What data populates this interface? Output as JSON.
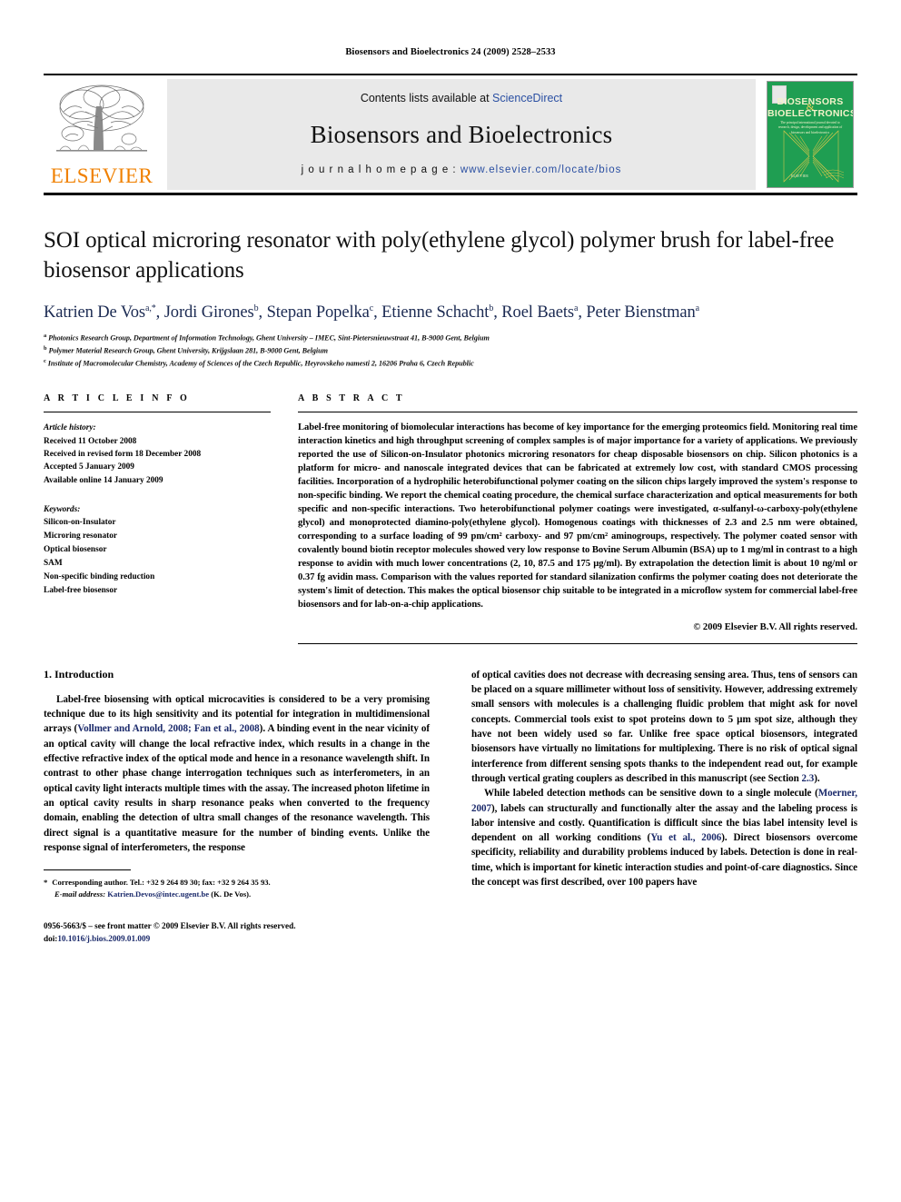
{
  "running_head": "Biosensors and Bioelectronics 24 (2009) 2528–2533",
  "masthead": {
    "publisher_name": "ELSEVIER",
    "contents_line": "Contents lists available at ",
    "sciencedirect": "ScienceDirect",
    "journal_title": "Biosensors and Bioelectronics",
    "homepage_label": "j o u r n a l   h o m e p a g e :  ",
    "homepage_url": "www.elsevier.com/locate/bios",
    "cover": {
      "title_line1": "BIOSENSORS",
      "amp": "&",
      "title_line2": "BIOELECTRONICS",
      "subtitle": "The principal international journal devoted to research, design, development and application of biosensors and bioelectronics",
      "publisher": "ELSEVIER",
      "background_color": "#1f9e52"
    }
  },
  "article": {
    "title": "SOI optical microring resonator with poly(ethylene glycol) polymer brush for label-free biosensor applications",
    "authors_html": "Katrien De Vos<sup>a,</sup><sup class=\"star\">*</sup>, Jordi Girones<sup>b</sup>, Stepan Popelka<sup>c</sup>, Etienne Schacht<sup>b</sup>, Roel Baets<sup>a</sup>, Peter Bienstman<sup>a</sup>",
    "affiliations": [
      {
        "marker": "a",
        "text": "Photonics Research Group, Department of Information Technology, Ghent University – IMEC, Sint-Pietersnieuwstraat 41, B-9000 Gent, Belgium"
      },
      {
        "marker": "b",
        "text": "Polymer Material Research Group, Ghent University, Krijgslaan 281, B-9000 Gent, Belgium"
      },
      {
        "marker": "c",
        "text": "Institute of Macromolecular Chemistry, Academy of Sciences of the Czech Republic, Heyrovskeho namesti 2, 16206 Praha 6, Czech Republic"
      }
    ]
  },
  "article_info": {
    "heading": "A R T I C L E   I N F O",
    "history_label": "Article history:",
    "history": [
      "Received 11 October 2008",
      "Received in revised form 18 December 2008",
      "Accepted 5 January 2009",
      "Available online 14 January 2009"
    ],
    "keywords_label": "Keywords:",
    "keywords": [
      "Silicon-on-Insulator",
      "Microring resonator",
      "Optical biosensor",
      "SAM",
      "Non-specific binding reduction",
      "Label-free biosensor"
    ]
  },
  "abstract": {
    "heading": "A B S T R A C T",
    "text": "Label-free monitoring of biomolecular interactions has become of key importance for the emerging proteomics field. Monitoring real time interaction kinetics and high throughput screening of complex samples is of major importance for a variety of applications. We previously reported the use of Silicon-on-Insulator photonics microring resonators for cheap disposable biosensors on chip. Silicon photonics is a platform for micro- and nanoscale integrated devices that can be fabricated at extremely low cost, with standard CMOS processing facilities. Incorporation of a hydrophilic heterobifunctional polymer coating on the silicon chips largely improved the system's response to non-specific binding. We report the chemical coating procedure, the chemical surface characterization and optical measurements for both specific and non-specific interactions. Two heterobifunctional polymer coatings were investigated, α-sulfanyl-ω-carboxy-poly(ethylene glycol) and monoprotected diamino-poly(ethylene glycol). Homogenous coatings with thicknesses of 2.3 and 2.5 nm were obtained, corresponding to a surface loading of 99 pm/cm² carboxy- and 97 pm/cm² aminogroups, respectively. The polymer coated sensor with covalently bound biotin receptor molecules showed very low response to Bovine Serum Albumin (BSA) up to 1 mg/ml in contrast to a high response to avidin with much lower concentrations (2, 10, 87.5 and 175 µg/ml). By extrapolation the detection limit is about 10 ng/ml or 0.37 fg avidin mass. Comparison with the values reported for standard silanization confirms the polymer coating does not deteriorate the system's limit of detection. This makes the optical biosensor chip suitable to be integrated in a microflow system for commercial label-free biosensors and for lab-on-a-chip applications.",
    "copyright": "© 2009 Elsevier B.V. All rights reserved."
  },
  "body": {
    "section_heading": "1.  Introduction",
    "left_paragraphs": [
      "Label-free biosensing with optical microcavities is considered to be a very promising technique due to its high sensitivity and its potential for integration in multidimensional arrays (<span class=\"ref\">Vollmer and Arnold, 2008; Fan et al., 2008</span>). A binding event in the near vicinity of an optical cavity will change the local refractive index, which results in a change in the effective refractive index of the optical mode and hence in a resonance wavelength shift. In contrast to other phase change interrogation techniques such as interferometers, in an optical cavity light interacts multiple times with the assay. The increased photon lifetime in an optical cavity results in sharp resonance peaks when converted to the frequency domain, enabling the detection of ultra small changes of the resonance wavelength. This direct signal is a quantitative measure for the number of binding events. Unlike the response signal of interferometers, the response"
    ],
    "right_paragraphs": [
      "of optical cavities does not decrease with decreasing sensing area. Thus, tens of sensors can be placed on a square millimeter without loss of sensitivity. However, addressing extremely small sensors with molecules is a challenging fluidic problem that might ask for novel concepts. Commercial tools exist to spot proteins down to 5 µm spot size, although they have not been widely used so far. Unlike free space optical biosensors, integrated biosensors have virtually no limitations for multiplexing. There is no risk of optical signal interference from different sensing spots thanks to the independent read out, for example through vertical grating couplers as described in this manuscript (see Section <span class=\"ref\">2.3</span>).",
      "While labeled detection methods can be sensitive down to a single molecule (<span class=\"ref\">Moerner, 2007</span>), labels can structurally and functionally alter the assay and the labeling process is labor intensive and costly. Quantification is difficult since the bias label intensity level is dependent on all working conditions (<span class=\"ref\">Yu et al., 2006</span>). Direct biosensors overcome specificity, reliability and durability problems induced by labels. Detection is done in real-time, which is important for kinetic interaction studies and point-of-care diagnostics. Since the concept was first described, over 100 papers have"
    ]
  },
  "footer": {
    "corresponding_marker": "*",
    "corresponding_text": "Corresponding author. Tel.: +32 9 264 89 30; fax: +32 9 264 35 93.",
    "email_label": "E-mail address:",
    "email": "Katrien.Devos@intec.ugent.be",
    "email_suffix": "(K. De Vos).",
    "issn_line": "0956-5663/$ – see front matter © 2009 Elsevier B.V. All rights reserved.",
    "doi_label": "doi:",
    "doi_value": "10.1016/j.bios.2009.01.009"
  }
}
